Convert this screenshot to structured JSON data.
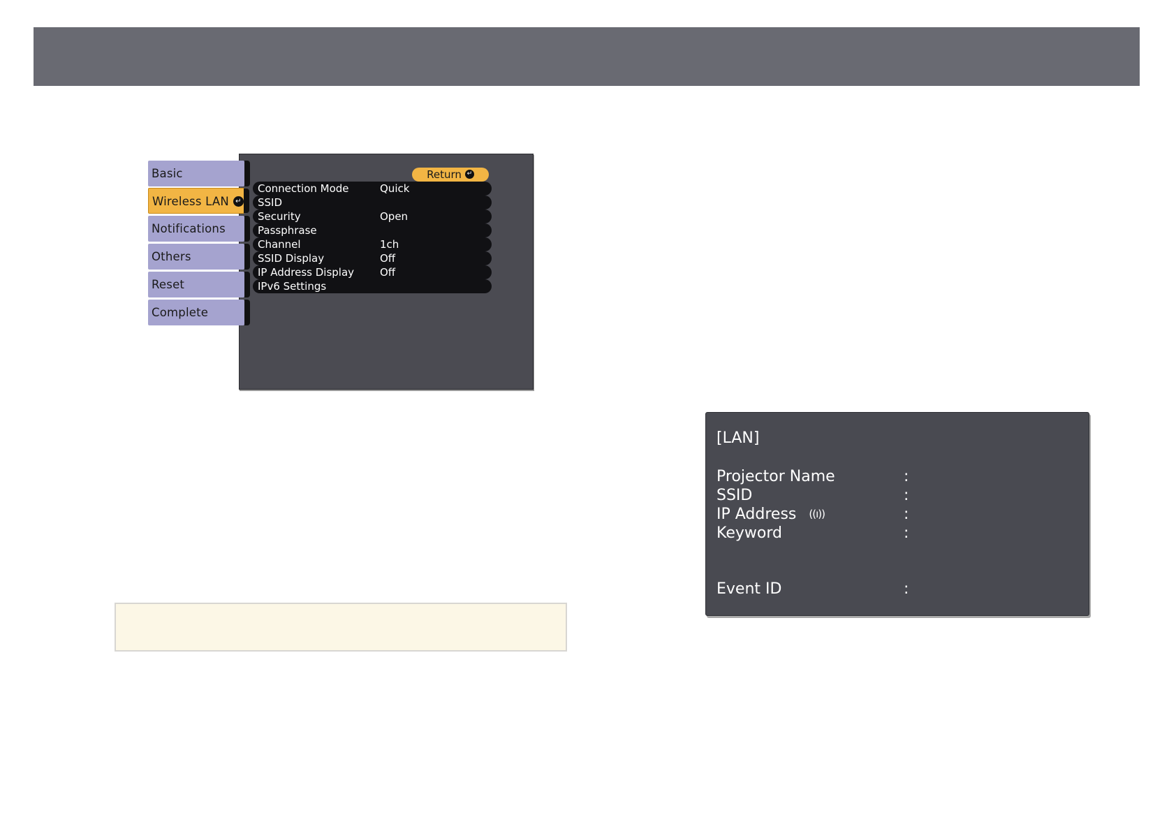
{
  "menu": {
    "tabs": [
      {
        "label": "Basic"
      },
      {
        "label": "Wireless LAN"
      },
      {
        "label": "Notifications"
      },
      {
        "label": "Others"
      },
      {
        "label": "Reset"
      },
      {
        "label": "Complete"
      }
    ],
    "selected_tab": "Wireless LAN",
    "return_label": "Return",
    "settings": [
      {
        "label": "Connection Mode",
        "value": "Quick"
      },
      {
        "label": "SSID",
        "value": ""
      },
      {
        "label": "Security",
        "value": "Open"
      },
      {
        "label": "Passphrase",
        "value": ""
      },
      {
        "label": "Channel",
        "value": "1ch"
      },
      {
        "label": "SSID Display",
        "value": "Off"
      },
      {
        "label": "IP Address Display",
        "value": "Off"
      },
      {
        "label": "IPv6 Settings",
        "value": ""
      }
    ]
  },
  "lan_screen": {
    "title": "[LAN]",
    "fields": [
      {
        "label": "Projector Name",
        "colon": ":"
      },
      {
        "label": "SSID",
        "colon": ":"
      },
      {
        "label": "IP Address",
        "colon": ":"
      },
      {
        "label": "Keyword",
        "colon": ":"
      },
      {
        "label": "Event ID",
        "colon": ":"
      }
    ]
  },
  "icons": {
    "enter": "enter-icon",
    "wireless": "wireless-signal-icon"
  },
  "colors": {
    "banner": "#696a72",
    "tab": "#a5a3cf",
    "selected": "#f2b544",
    "panel": "#4b4b52",
    "note_bg": "#fcf7e6"
  }
}
